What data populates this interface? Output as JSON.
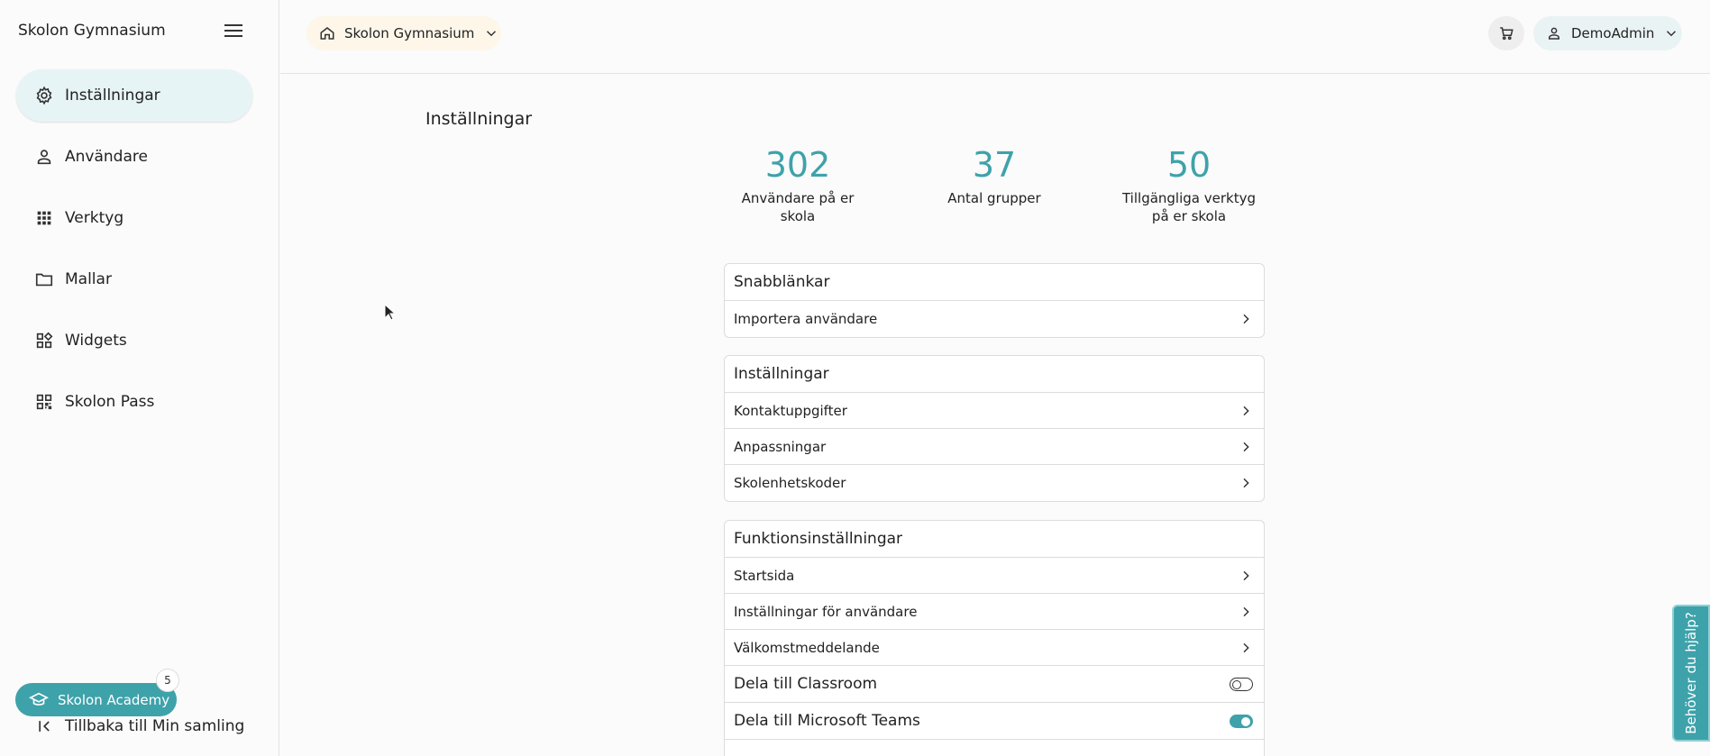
{
  "sidebar": {
    "title": "Skolon Gymnasium",
    "items": [
      {
        "label": "Inställningar",
        "icon": "gear-icon",
        "active": true
      },
      {
        "label": "Användare",
        "icon": "person-icon",
        "active": false
      },
      {
        "label": "Verktyg",
        "icon": "grid-icon",
        "active": false
      },
      {
        "label": "Mallar",
        "icon": "folder-icon",
        "active": false
      },
      {
        "label": "Widgets",
        "icon": "widgets-icon",
        "active": false
      },
      {
        "label": "Skolon Pass",
        "icon": "qr-icon",
        "active": false
      }
    ],
    "academy_label": "Skolon Academy",
    "academy_badge": "5",
    "back_label": "Tillbaka till Min samling"
  },
  "header": {
    "school": "Skolon Gymnasium",
    "user": "DemoAdmin"
  },
  "main": {
    "title": "Inställningar",
    "stats": [
      {
        "value": "302",
        "caption": "Användare på er skola"
      },
      {
        "value": "37",
        "caption": "Antal grupper"
      },
      {
        "value": "50",
        "caption": "Tillgängliga verktyg på er skola"
      }
    ],
    "quicklinks": {
      "title": "Snabblänkar",
      "rows": [
        "Importera användare"
      ]
    },
    "settings": {
      "title": "Inställningar",
      "rows": [
        "Kontaktuppgifter",
        "Anpassningar",
        "Skolenhetskoder"
      ]
    },
    "functions": {
      "title": "Funktionsinställningar",
      "rows": [
        "Startsida",
        "Inställningar för användare",
        "Välkomstmeddelande"
      ],
      "toggles": [
        {
          "label": "Dela till Classroom",
          "on": false
        },
        {
          "label": "Dela till Microsoft Teams",
          "on": true
        }
      ]
    }
  },
  "help_label": "Behöver du hjälp?",
  "colors": {
    "accent": "#3ea2aa",
    "active_nav": "#e7f4f5",
    "school_pill": "#fdf6e9"
  }
}
